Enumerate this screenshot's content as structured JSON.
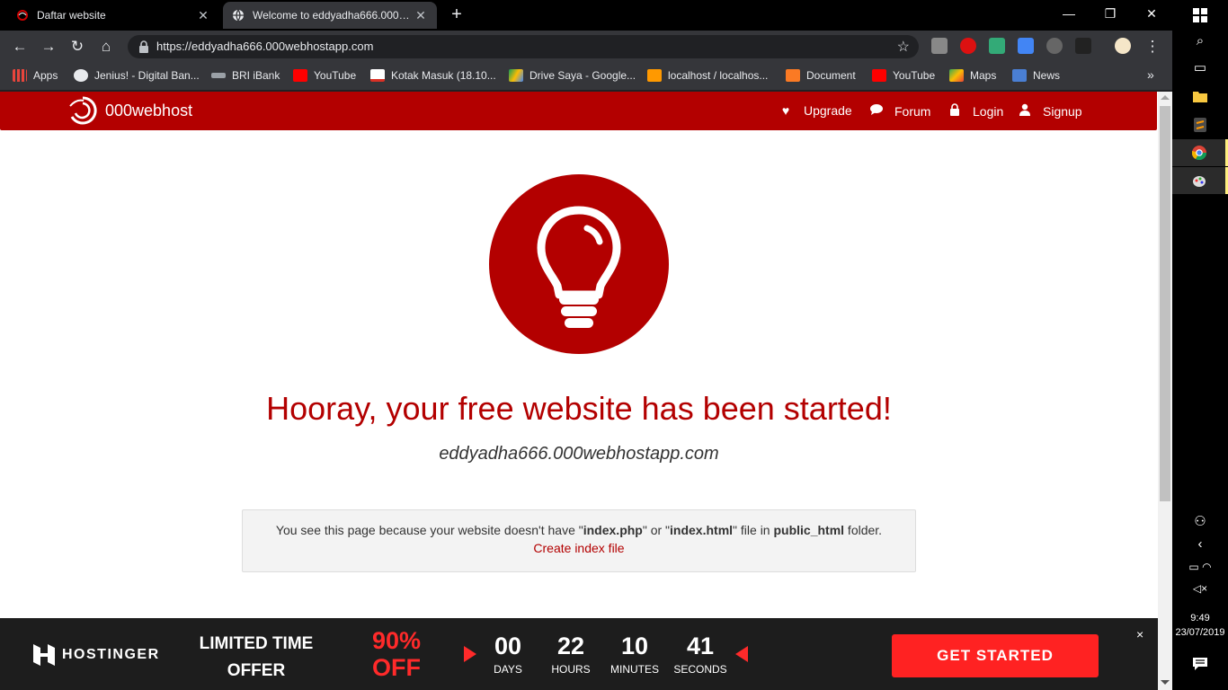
{
  "browser": {
    "tabs": [
      {
        "title": "Daftar website",
        "active": false
      },
      {
        "title": "Welcome to eddyadha666.000webhostapp.com",
        "active": true
      }
    ],
    "url": "https://eddyadha666.000webhostapp.com",
    "bookmarks": [
      {
        "label": "Apps",
        "icon": "apps-grid-icon"
      },
      {
        "label": "Jenius! - Digital Ban...",
        "icon": "globe-icon"
      },
      {
        "label": "BRI iBank",
        "icon": "bri-icon"
      },
      {
        "label": "YouTube",
        "icon": "youtube-icon"
      },
      {
        "label": "Kotak Masuk (18.10...",
        "icon": "gmail-icon"
      },
      {
        "label": "Drive Saya - Google...",
        "icon": "drive-icon"
      },
      {
        "label": "localhost / localhos...",
        "icon": "phpmyadmin-icon"
      },
      {
        "label": "Document",
        "icon": "xampp-icon"
      },
      {
        "label": "YouTube",
        "icon": "youtube-icon"
      },
      {
        "label": "Maps",
        "icon": "maps-icon"
      },
      {
        "label": "News",
        "icon": "news-icon"
      }
    ],
    "bookmarks_more": "»"
  },
  "site": {
    "brand": "000webhost",
    "nav": [
      {
        "label": "Upgrade",
        "icon": "heart-icon"
      },
      {
        "label": "Forum",
        "icon": "chat-icon"
      },
      {
        "label": "Login",
        "icon": "lock-icon"
      },
      {
        "label": "Signup",
        "icon": "user-icon"
      }
    ],
    "headline": "Hooray, your free website has been started!",
    "domain": "eddyadha666.000webhostapp.com",
    "notice": {
      "part1": "You see this page because your website doesn't have \"",
      "file1": "index.php",
      "part2": "\" or \"",
      "file2": "index.html",
      "part3": "\" file in ",
      "folder": "public_html",
      "part4": " folder.",
      "link": "Create index file"
    }
  },
  "promo": {
    "brand": "HOSTINGER",
    "offer_line1": "LIMITED TIME",
    "offer_line2": "OFFER",
    "discount_line1": "90%",
    "discount_line2": "OFF",
    "countdown": [
      {
        "value": "00",
        "label": "DAYS"
      },
      {
        "value": "22",
        "label": "HOURS"
      },
      {
        "value": "10",
        "label": "MINUTES"
      },
      {
        "value": "41",
        "label": "SECONDS"
      }
    ],
    "cta": "GET STARTED",
    "close": "×"
  },
  "taskbar": {
    "time": "9:49",
    "date": "23/07/2019"
  },
  "colors": {
    "brand_red": "#b30000",
    "promo_red": "#ff2222",
    "promo_bg": "#1d1d1d"
  }
}
